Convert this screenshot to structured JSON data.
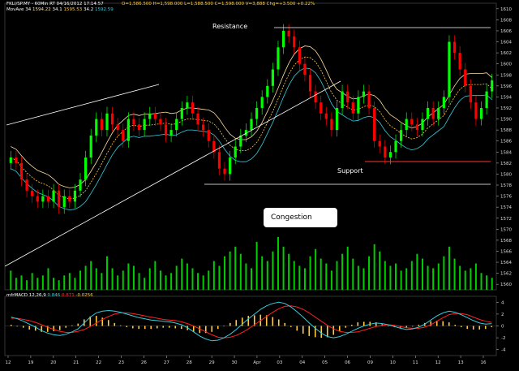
{
  "header": {
    "symbol_line": "FKLI/SP.MY - 60Min RT  04/16/2012 17:14:57",
    "ohlc_line": "O=1,586.500  H=1,598.000  L=1,588.500  C=1,598.000  V=3,888  Chg=+3.500  +0.22%",
    "mov_label": "MovAve 34",
    "mov_values": [
      "1594.22",
      "34.1",
      "1595.53",
      "34.2",
      "1592.59"
    ],
    "macd_label": "mfrMACD 12,26,9",
    "macd_values": [
      "0.846",
      "0.871",
      "-0.0256"
    ]
  },
  "annotations": {
    "resistance": "Resistance",
    "support": "Support",
    "congestion": "Congestion"
  },
  "colors": {
    "background": "#000000",
    "bull": "#00ff00",
    "bear": "#ff0000",
    "ma_fast": "#ffe0a0",
    "ma_mid": "#ffcc44",
    "ma_slow": "#33ccdd",
    "macd_line": "#33ccdd",
    "signal_line": "#ff2222",
    "histogram": "#ffcc44",
    "volume": "#00cc00",
    "support_line": "#ff3333"
  },
  "chart_data": {
    "type": "candlestick",
    "price_axis_ticks": [
      1610,
      1608,
      1606,
      1604,
      1602,
      1600,
      1598,
      1596,
      1594,
      1592,
      1590,
      1588,
      1586,
      1584,
      1582,
      1580,
      1578,
      1576,
      1574,
      1572,
      1570,
      1568,
      1566,
      1564,
      1562,
      1560
    ],
    "price_range": [
      1559,
      1611
    ],
    "macd_axis_ticks": [
      4,
      2,
      0,
      -2,
      -4
    ],
    "macd_range": [
      -5,
      5
    ],
    "x_ticks": [
      "12",
      "19",
      "20",
      "21",
      "22",
      "23",
      "26",
      "27",
      "28",
      "29",
      "30",
      "Apr",
      "03",
      "04",
      "05",
      "06",
      "09",
      "10",
      "11",
      "12",
      "13",
      "16"
    ],
    "closes": [
      1583,
      1582,
      1579,
      1577,
      1576,
      1575,
      1576,
      1575,
      1577,
      1574,
      1576,
      1575,
      1577,
      1579,
      1583,
      1587,
      1590,
      1588,
      1591,
      1589,
      1588,
      1586,
      1590,
      1589,
      1588,
      1590,
      1591,
      1590,
      1589,
      1587,
      1588,
      1590,
      1592,
      1593,
      1591,
      1589,
      1588,
      1586,
      1584,
      1581,
      1580,
      1583,
      1585,
      1587,
      1588,
      1590,
      1592,
      1594,
      1596,
      1599,
      1603,
      1606,
      1605,
      1603,
      1600,
      1598,
      1595,
      1593,
      1591,
      1590,
      1588,
      1592,
      1595,
      1593,
      1591,
      1594,
      1595,
      1592,
      1586,
      1585,
      1583,
      1584,
      1586,
      1588,
      1590,
      1589,
      1588,
      1590,
      1592,
      1590,
      1592,
      1594,
      1604,
      1602,
      1599,
      1596,
      1593,
      1590,
      1592,
      1595,
      1597
    ],
    "resistance_level": 1606.5,
    "support_level_red": 1582,
    "support_level_white": 1578.5,
    "volume": [
      8,
      5,
      6,
      4,
      7,
      5,
      6,
      9,
      5,
      4,
      6,
      7,
      5,
      8,
      10,
      12,
      9,
      7,
      14,
      9,
      6,
      8,
      11,
      10,
      7,
      5,
      9,
      12,
      8,
      6,
      7,
      10,
      13,
      11,
      9,
      7,
      6,
      8,
      12,
      10,
      14,
      16,
      18,
      15,
      11,
      9,
      20,
      14,
      12,
      16,
      22,
      18,
      15,
      12,
      10,
      9,
      14,
      17,
      13,
      11,
      8,
      12,
      15,
      18,
      13,
      10,
      9,
      14,
      19,
      16,
      12,
      10,
      11,
      8,
      9,
      12,
      15,
      13,
      10,
      9,
      11,
      14,
      18,
      13,
      10,
      8,
      9,
      11,
      7,
      6,
      5
    ],
    "macd": [
      1.5,
      1.2,
      0.8,
      0.3,
      -0.2,
      -0.8,
      -1.2,
      -1.5,
      -1.6,
      -1.4,
      -1.0,
      -0.5,
      0.5,
      1.5,
      2.2,
      2.5,
      2.6,
      2.5,
      2.3,
      2.0,
      1.7,
      1.4,
      1.2,
      1.0,
      0.9,
      0.8,
      0.7,
      0.5,
      0.2,
      -0.3,
      -1.0,
      -1.7,
      -2.2,
      -2.5,
      -2.4,
      -2.0,
      -1.4,
      -0.6,
      0.3,
      1.2,
      2.0,
      2.8,
      3.4,
      3.8,
      4.0,
      3.8,
      3.2,
      2.4,
      1.5,
      0.5,
      -0.4,
      -1.2,
      -1.8,
      -2.0,
      -1.8,
      -1.4,
      -0.9,
      -0.4,
      0.0,
      0.3,
      0.5,
      0.4,
      0.2,
      -0.1,
      -0.4,
      -0.6,
      -0.5,
      -0.2,
      0.3,
      1.0,
      1.7,
      2.2,
      2.5,
      2.3,
      1.9,
      1.4,
      0.9,
      0.5,
      0.3,
      0.4
    ],
    "signal": [
      1.3,
      1.3,
      1.1,
      0.9,
      0.6,
      0.2,
      -0.2,
      -0.6,
      -0.9,
      -1.1,
      -1.1,
      -0.9,
      -0.6,
      -0.1,
      0.5,
      1.1,
      1.6,
      2.0,
      2.2,
      2.2,
      2.1,
      1.9,
      1.7,
      1.5,
      1.3,
      1.1,
      1.0,
      0.9,
      0.7,
      0.4,
      0.0,
      -0.5,
      -1.0,
      -1.5,
      -1.9,
      -2.0,
      -1.9,
      -1.6,
      -1.1,
      -0.5,
      0.2,
      0.9,
      1.6,
      2.3,
      2.9,
      3.3,
      3.4,
      3.2,
      2.8,
      2.2,
      1.5,
      0.8,
      0.1,
      -0.5,
      -0.9,
      -1.1,
      -1.1,
      -1.0,
      -0.7,
      -0.4,
      -0.1,
      0.1,
      0.2,
      0.1,
      -0.1,
      -0.3,
      -0.4,
      -0.4,
      -0.2,
      0.2,
      0.8,
      1.4,
      1.9,
      2.1,
      2.1,
      1.9,
      1.5,
      1.1,
      0.8,
      0.6
    ]
  }
}
